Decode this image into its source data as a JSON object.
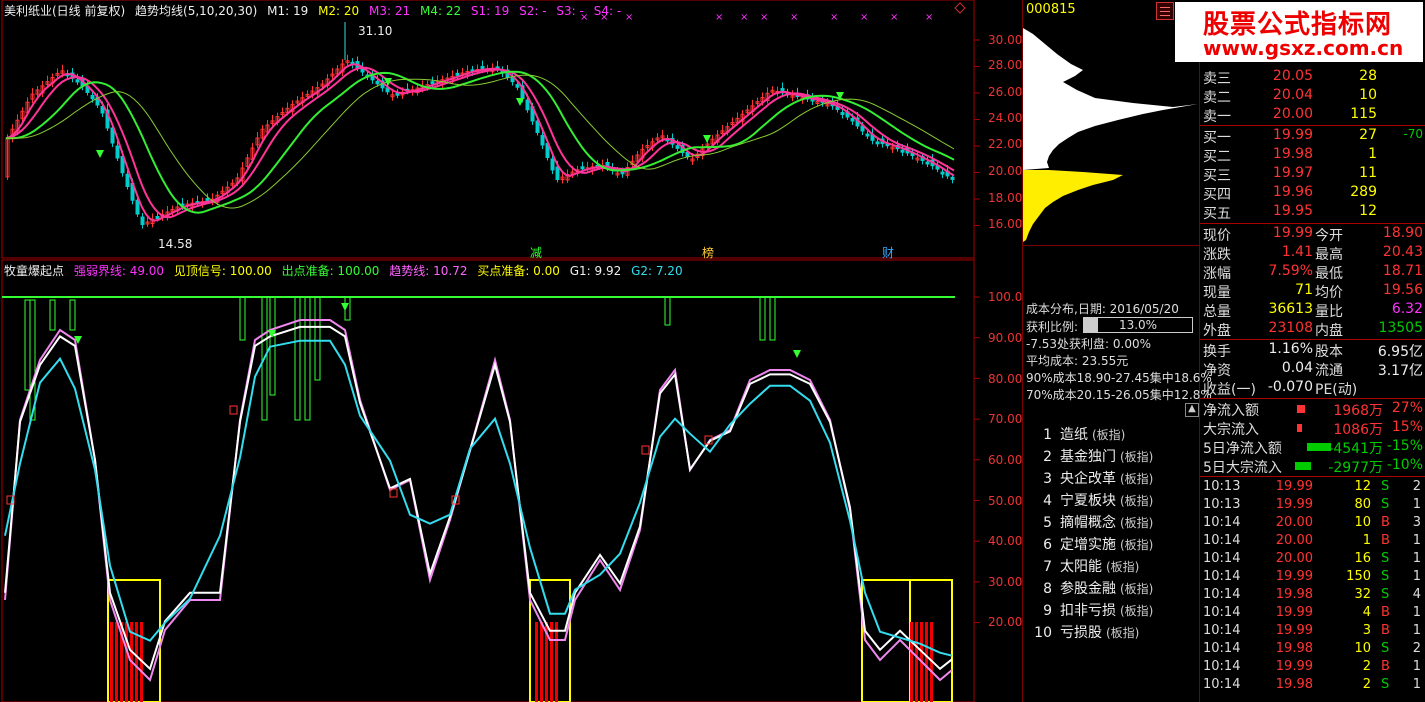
{
  "header1": {
    "stock": "美利纸业(日线 前复权)",
    "indicator": "趋势均线(5,10,20,30)",
    "m1": "M1: 19",
    "m2": "M2: 20",
    "m3": "M3: 21",
    "m4": "M4: 22",
    "s1": "S1: 19",
    "s2": "S2: -",
    "s3": "S3: -",
    "s4": "S4: -"
  },
  "header2": {
    "name": "牧童爆起点",
    "strong_weak": "强弱界线: 49.00",
    "top_signal": "见顶信号: 100.00",
    "exit_ready": "出点准备: 100.00",
    "trend": "趋势线: 10.72",
    "buy_ready": "买点准备: 0.00",
    "g1": "G1: 9.92",
    "g2": "G2: 7.20"
  },
  "price_axis": [
    "30.00",
    "28.00",
    "26.00",
    "24.00",
    "22.00",
    "20.00",
    "18.00",
    "16.00"
  ],
  "ind_axis": [
    "100.0",
    "90.00",
    "80.00",
    "70.00",
    "60.00",
    "50.00",
    "40.00",
    "30.00",
    "20.00"
  ],
  "annotations": {
    "high": "31.10",
    "low": "14.58",
    "marker1": "减",
    "marker2": "榜",
    "marker3": "财"
  },
  "code": "000815",
  "logo": {
    "line1": "股票公式指标网",
    "line2": "www.gsxz.com.cn"
  },
  "orderbook": {
    "asks": [
      {
        "label": "卖三",
        "price": "20.05",
        "vol": "28"
      },
      {
        "label": "卖二",
        "price": "20.04",
        "vol": "10"
      },
      {
        "label": "卖一",
        "price": "20.00",
        "vol": "115"
      }
    ],
    "bids": [
      {
        "label": "买一",
        "price": "19.99",
        "vol": "27",
        "chg": "-70"
      },
      {
        "label": "买二",
        "price": "19.98",
        "vol": "1"
      },
      {
        "label": "买三",
        "price": "19.97",
        "vol": "11"
      },
      {
        "label": "买四",
        "price": "19.96",
        "vol": "289"
      },
      {
        "label": "买五",
        "price": "19.95",
        "vol": "12"
      }
    ]
  },
  "stats": [
    {
      "l1": "现价",
      "v1": "19.99",
      "l2": "今开",
      "v2": "18.90"
    },
    {
      "l1": "涨跌",
      "v1": "1.41",
      "l2": "最高",
      "v2": "20.43"
    },
    {
      "l1": "涨幅",
      "v1": "7.59%",
      "l2": "最低",
      "v2": "18.71"
    },
    {
      "l1": "现量",
      "v1": "71",
      "l2": "均价",
      "v2": "19.56"
    },
    {
      "l1": "总量",
      "v1": "36613",
      "l2": "量比",
      "v2": "6.32"
    },
    {
      "l1": "外盘",
      "v1": "23108",
      "l2": "内盘",
      "v2": "13505"
    }
  ],
  "fundamentals": [
    {
      "l1": "换手",
      "v1": "1.16%",
      "l2": "股本",
      "v2": "6.95亿"
    },
    {
      "l1": "净资",
      "v1": "0.04",
      "l2": "流通",
      "v2": "3.17亿"
    },
    {
      "l1": "收益(一)",
      "v1": "-0.070",
      "l2": "PE(动)",
      "v2": ""
    }
  ],
  "flows": [
    {
      "label": "净流入额",
      "value": "1968万",
      "pct": "27%"
    },
    {
      "label": "大宗流入",
      "value": "1086万",
      "pct": "15%"
    },
    {
      "label": "5日净流入额",
      "value": "-4541万",
      "pct": "-15%"
    },
    {
      "label": "5日大宗流入",
      "value": "-2977万",
      "pct": "-10%"
    }
  ],
  "ticks": [
    {
      "t": "10:13",
      "p": "19.99",
      "v": "12",
      "d": "S",
      "n": "2"
    },
    {
      "t": "10:13",
      "p": "19.99",
      "v": "80",
      "d": "S",
      "n": "1"
    },
    {
      "t": "10:14",
      "p": "20.00",
      "v": "10",
      "d": "B",
      "n": "3"
    },
    {
      "t": "10:14",
      "p": "20.00",
      "v": "1",
      "d": "B",
      "n": "1"
    },
    {
      "t": "10:14",
      "p": "20.00",
      "v": "16",
      "d": "S",
      "n": "1"
    },
    {
      "t": "10:14",
      "p": "19.99",
      "v": "150",
      "d": "S",
      "n": "1"
    },
    {
      "t": "10:14",
      "p": "19.98",
      "v": "32",
      "d": "S",
      "n": "4"
    },
    {
      "t": "10:14",
      "p": "19.99",
      "v": "4",
      "d": "B",
      "n": "1"
    },
    {
      "t": "10:14",
      "p": "19.99",
      "v": "3",
      "d": "B",
      "n": "1"
    },
    {
      "t": "10:14",
      "p": "19.98",
      "v": "10",
      "d": "S",
      "n": "2"
    },
    {
      "t": "10:14",
      "p": "19.99",
      "v": "2",
      "d": "B",
      "n": "1"
    },
    {
      "t": "10:14",
      "p": "19.98",
      "v": "2",
      "d": "S",
      "n": "1"
    }
  ],
  "cost": {
    "title": "成本分布,日期: 2016/05/20",
    "profit_label": "获利比例:",
    "profit_value": "13.0%",
    "profit_fraction": 0.13,
    "line1": "-7.53处获利盘: 0.00%",
    "line2": "平均成本: 23.55元",
    "line3": "90%成本18.90-27.45集中18.6%",
    "line4": "70%成本20.15-26.05集中12.8%"
  },
  "sectors": [
    {
      "n": "1",
      "name": "造纸",
      "tag": "(板指)"
    },
    {
      "n": "2",
      "name": "基金独门",
      "tag": "(板指)"
    },
    {
      "n": "3",
      "name": "央企改革",
      "tag": "(板指)"
    },
    {
      "n": "4",
      "name": "宁夏板块",
      "tag": "(板指)"
    },
    {
      "n": "5",
      "name": "摘帽概念",
      "tag": "(板指)"
    },
    {
      "n": "6",
      "name": "定增实施",
      "tag": "(板指)"
    },
    {
      "n": "7",
      "name": "太阳能",
      "tag": "(板指)"
    },
    {
      "n": "8",
      "name": "参股金融",
      "tag": "(板指)"
    },
    {
      "n": "9",
      "name": "扣非亏损",
      "tag": "(板指)"
    },
    {
      "n": "10",
      "name": "亏损股",
      "tag": "(板指)"
    }
  ],
  "colors": {
    "up": "#ff3333",
    "down": "#00cccc",
    "ma_green": "#33ee33",
    "ma_pink": "#ff3399",
    "ind_white": "#ffffff",
    "ind_pink": "#ee88ee",
    "ind_cyan": "#33ddee"
  }
}
